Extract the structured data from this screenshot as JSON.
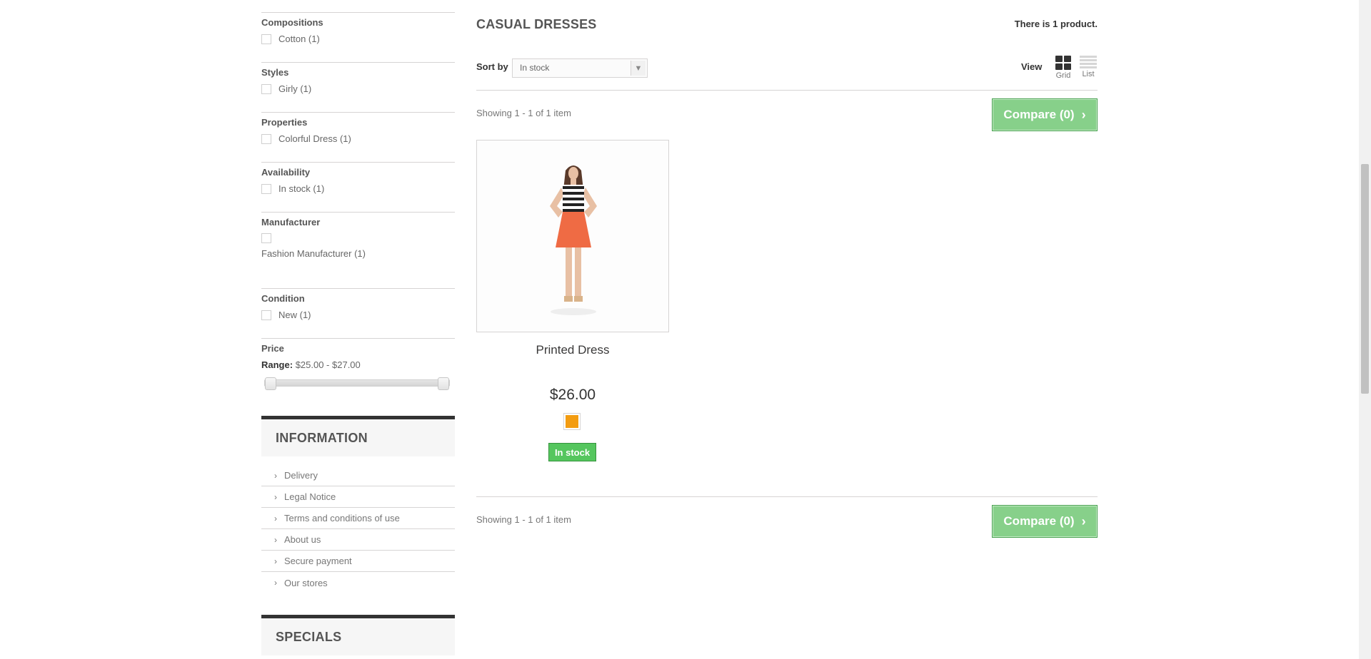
{
  "filters": {
    "compositions": {
      "title": "Compositions",
      "item": "Cotton (1)"
    },
    "styles": {
      "title": "Styles",
      "item": "Girly (1)"
    },
    "properties": {
      "title": "Properties",
      "item": "Colorful Dress (1)"
    },
    "availability": {
      "title": "Availability",
      "item": "In stock (1)"
    },
    "manufacturer": {
      "title": "Manufacturer",
      "item": "Fashion Manufacturer (1)"
    },
    "condition": {
      "title": "Condition",
      "item": "New (1)"
    },
    "price": {
      "title": "Price",
      "range_label": "Range:",
      "range_value": "$25.00 - $27.00",
      "range_min_fraction": 0.0,
      "range_max_fraction": 1.0
    }
  },
  "information": {
    "title": "INFORMATION",
    "links": [
      "Delivery",
      "Legal Notice",
      "Terms and conditions of use",
      "About us",
      "Secure payment",
      "Our stores"
    ]
  },
  "specials": {
    "title": "SPECIALS"
  },
  "main": {
    "heading": "CASUAL DRESSES",
    "counter": "There is 1 product.",
    "sort_label": "Sort by",
    "sort_value": "In stock",
    "view_label": "View",
    "view_grid": "Grid",
    "view_list": "List",
    "showing_top": "Showing 1 - 1 of 1 item",
    "showing_bottom": "Showing 1 - 1 of 1 item",
    "compare_label": "Compare (0)"
  },
  "product": {
    "name": "Printed Dress",
    "price": "$26.00",
    "color": "#f39c11",
    "stock": "In stock"
  },
  "colors": {
    "compare_green": "#87d08a",
    "stock_green": "#55c65e",
    "block_border": "#333333"
  }
}
